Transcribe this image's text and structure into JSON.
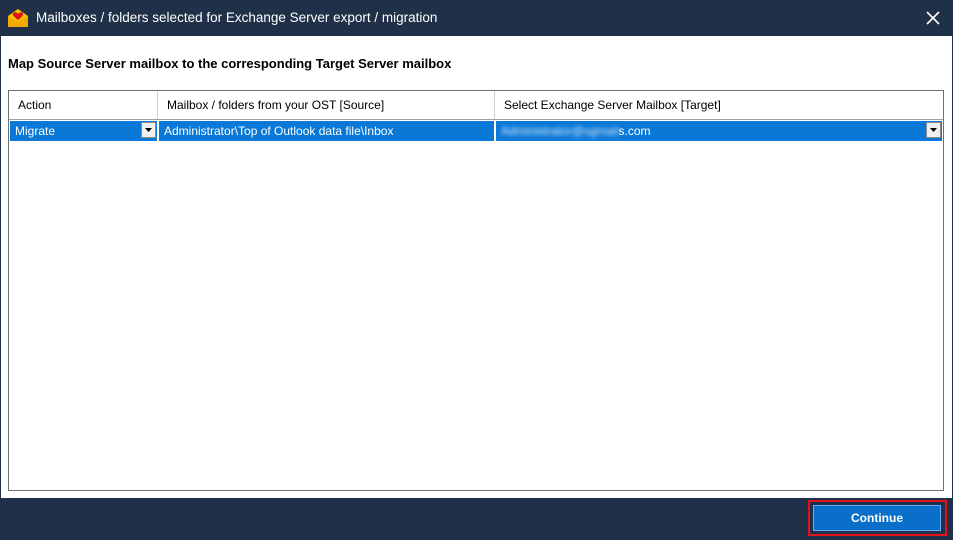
{
  "window": {
    "title": "Mailboxes / folders selected for Exchange Server export / migration",
    "icon": "mail-app-icon",
    "close_icon": "close-icon"
  },
  "instruction": "Map Source Server mailbox to the corresponding Target Server mailbox",
  "grid": {
    "columns": [
      "Action",
      "Mailbox / folders from your OST [Source]",
      "Select Exchange Server Mailbox [Target]"
    ],
    "rows": [
      {
        "action": "Migrate",
        "source": "Administrator\\Top of Outlook data file\\Inbox",
        "target_blurred": "Administrator@sgmail",
        "target_suffix": "s.com",
        "selected": true
      }
    ]
  },
  "footer": {
    "continue_label": "Continue"
  },
  "colors": {
    "titlebar": "#1f3048",
    "selection": "#0a78d7",
    "button": "#0a6fc9",
    "highlight": "#e0131d"
  }
}
